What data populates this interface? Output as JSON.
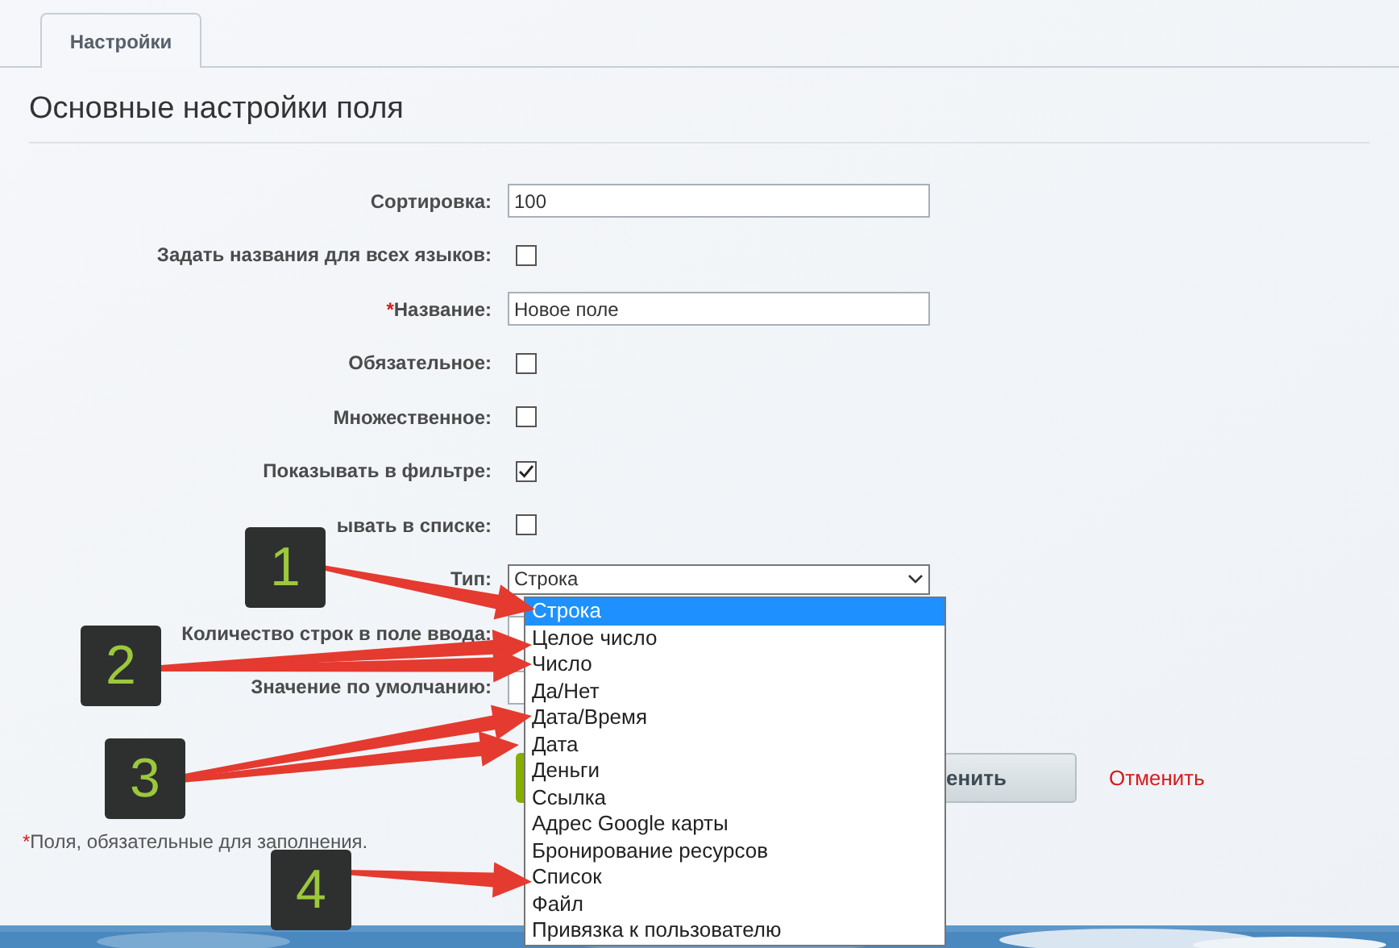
{
  "tabs": [
    {
      "label": "Настройки",
      "selected": true
    }
  ],
  "heading": "Основные настройки поля",
  "rows": [
    {
      "label": "Сортировка:",
      "kind": "input",
      "value": "100"
    },
    {
      "label": "Задать названия для всех языков:",
      "kind": "checkbox",
      "checked": false
    },
    {
      "label": "Название:",
      "required_mark": "*",
      "kind": "input",
      "value": "Новое поле"
    },
    {
      "label": "Обязательное:",
      "kind": "checkbox",
      "checked": false
    },
    {
      "label": "Множественное:",
      "kind": "checkbox",
      "checked": false
    },
    {
      "label": "Показывать в фильтре:",
      "kind": "checkbox",
      "checked": true
    },
    {
      "label": "ывать в списке:",
      "kind": "checkbox",
      "checked": false
    },
    {
      "label": "Тип:",
      "kind": "select",
      "value": "Строка"
    },
    {
      "label": "Количество строк в поле ввода:",
      "kind": "input",
      "value": ""
    },
    {
      "label": "Значение по умолчанию:",
      "kind": "input",
      "value": ""
    }
  ],
  "type_options": [
    {
      "label": "Строка",
      "selected": true
    },
    {
      "label": "Целое число",
      "selected": false
    },
    {
      "label": "Число",
      "selected": false
    },
    {
      "label": "Да/Нет",
      "selected": false
    },
    {
      "label": "Дата/Время",
      "selected": false
    },
    {
      "label": "Дата",
      "selected": false
    },
    {
      "label": "Деньги",
      "selected": false
    },
    {
      "label": "Ссылка",
      "selected": false
    },
    {
      "label": "Адрес Google карты",
      "selected": false
    },
    {
      "label": "Бронирование ресурсов",
      "selected": false
    },
    {
      "label": "Список",
      "selected": false
    },
    {
      "label": "Файл",
      "selected": false
    },
    {
      "label": "Привязка к пользователю",
      "selected": false
    }
  ],
  "buttons": {
    "apply": "енить",
    "cancel": "Отменить"
  },
  "note": {
    "mark": "*",
    "text": "Поля, обязательные для заполнения."
  },
  "annotations": [
    "1",
    "2",
    "3",
    "4"
  ]
}
